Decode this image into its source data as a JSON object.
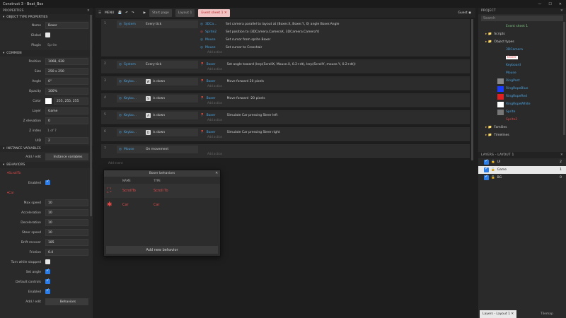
{
  "title": "Construct 3 - Beat_Box",
  "left_panel": {
    "header": "PROPERTIES",
    "sections": {
      "object_type": "OBJECT TYPE PROPERTIES",
      "common": "COMMON",
      "instance_vars": "INSTANCE VARIABLES",
      "behaviors": "BEHAVIORS"
    },
    "object_type": [
      {
        "label": "Name",
        "value": "Boxer"
      },
      {
        "label": "Global",
        "value": ""
      },
      {
        "label": "Plugin",
        "value": "Sprite"
      }
    ],
    "common": [
      {
        "label": "Position",
        "value": "1068, 628"
      },
      {
        "label": "Size",
        "value": "250 x 250"
      },
      {
        "label": "Angle",
        "value": "0°"
      },
      {
        "label": "Opacity",
        "value": "100%"
      },
      {
        "label": "Color",
        "value": "255, 255, 255"
      },
      {
        "label": "Layer",
        "value": "Game"
      },
      {
        "label": "Z elevation",
        "value": "0"
      },
      {
        "label": "Z index",
        "value": "1 of 7"
      },
      {
        "label": "UID",
        "value": "2"
      }
    ],
    "instance_vars": {
      "label": "Add / edit",
      "button": "Instance variables"
    },
    "behaviors": {
      "scrollto": "ScrollTo",
      "enabled_label": "Enabled",
      "car": "Car",
      "props": [
        {
          "label": "Max speed",
          "value": "10"
        },
        {
          "label": "Acceleration",
          "value": "10"
        },
        {
          "label": "Deceleration",
          "value": "10"
        },
        {
          "label": "Steer speed",
          "value": "10"
        },
        {
          "label": "Drift recover",
          "value": "185"
        },
        {
          "label": "Friction",
          "value": "0.4"
        }
      ],
      "checks": [
        "Turn while stopped",
        "Set angle",
        "Default controls",
        "Enabled"
      ],
      "add_label": "Add / edit",
      "add_button": "Behaviors"
    }
  },
  "toolbar": {
    "menu": "MENU",
    "tabs": [
      "Start page",
      "Layout 1",
      "Event sheet 1"
    ],
    "guest": "Guest"
  },
  "events": [
    {
      "num": "1",
      "cond_obj": "System",
      "cond": "Every tick",
      "actions": [
        {
          "obj": "3DCa...",
          "txt": "Set camera parallel to layout at (Boxer.X, Boxer.Y, 0) angle Boxer.Angle"
        },
        {
          "obj": "Sprite2",
          "txt": "Set position to (3DCamera.CameraX, 3DCamera.CameraY)"
        },
        {
          "obj": "Mouse",
          "txt": "Set cursor from sprite Boxer"
        },
        {
          "obj": "Mouse",
          "txt": "Set cursor to Crosshair"
        }
      ]
    },
    {
      "num": "2",
      "cond_obj": "System",
      "cond": "Every tick",
      "actions": [
        {
          "obj": "Boxer",
          "txt": "Set angle toward (lerp(ScrollX, Mouse.X, 0.2+dt), lerp(ScrollY, mouse.Y, 0.2+dt))"
        }
      ]
    },
    {
      "num": "3",
      "cond_obj": "Keybo...",
      "key": "W",
      "cond": "is down",
      "actions": [
        {
          "obj": "Boxer",
          "txt": "Move forward 20 pixels"
        }
      ]
    },
    {
      "num": "4",
      "cond_obj": "Keybo...",
      "key": "S",
      "cond": "is down",
      "actions": [
        {
          "obj": "Boxer",
          "txt": "Move forward -20 pixels"
        }
      ]
    },
    {
      "num": "5",
      "cond_obj": "Keybo...",
      "key": "A",
      "cond": "is down",
      "actions": [
        {
          "obj": "Boxer",
          "txt": "Simulate Car pressing Steer left"
        }
      ]
    },
    {
      "num": "6",
      "cond_obj": "Keybo...",
      "key": "D",
      "cond": "is down",
      "actions": [
        {
          "obj": "Boxer",
          "txt": "Simulate Car pressing Steer right"
        }
      ]
    },
    {
      "num": "7",
      "cond_obj": "Mouse",
      "cond": "On movement",
      "actions": []
    }
  ],
  "add_action": "Add action",
  "add_event": "Add event",
  "dialog": {
    "title": "Boxer behaviors",
    "col_name": "NAME",
    "col_type": "TYPE",
    "rows": [
      {
        "name": "ScrollTo",
        "type": "Scroll To"
      },
      {
        "name": "Car",
        "type": "Car"
      }
    ],
    "add": "Add new behavior"
  },
  "project": {
    "header": "PROJECT",
    "search": "Search",
    "items": [
      {
        "name": "Event sheet 1",
        "color": "#7ec37e"
      },
      {
        "name": "Scripts",
        "color": "#cfcfcf"
      },
      {
        "name": "Object types",
        "color": "#cfcfcf"
      },
      {
        "name": "3DCamera",
        "color": "#4aa3df"
      },
      {
        "name": "Boxer",
        "color": "#e04848"
      },
      {
        "name": "Keyboard",
        "color": "#4aa3df"
      },
      {
        "name": "Mouse",
        "color": "#4aa3df"
      },
      {
        "name": "RingPost",
        "color": "#4aa3df"
      },
      {
        "name": "RingRopeBlue",
        "color": "#4aa3df"
      },
      {
        "name": "RingRopeRed",
        "color": "#4aa3df"
      },
      {
        "name": "RingRopeWhite",
        "color": "#4aa3df"
      },
      {
        "name": "Sprite",
        "color": "#4aa3df"
      },
      {
        "name": "Sprite2",
        "color": "#e04848"
      },
      {
        "name": "Families",
        "color": "#cfcfcf"
      },
      {
        "name": "Timelines",
        "color": "#cfcfcf"
      }
    ]
  },
  "layers": {
    "header": "LAYERS - LAYOUT 1",
    "rows": [
      {
        "name": "UI",
        "num": "2"
      },
      {
        "name": "Game",
        "num": "1"
      },
      {
        "name": "BG",
        "num": "0"
      }
    ],
    "tab1": "Layers - Layout 1",
    "tab2": "Tilemap"
  }
}
